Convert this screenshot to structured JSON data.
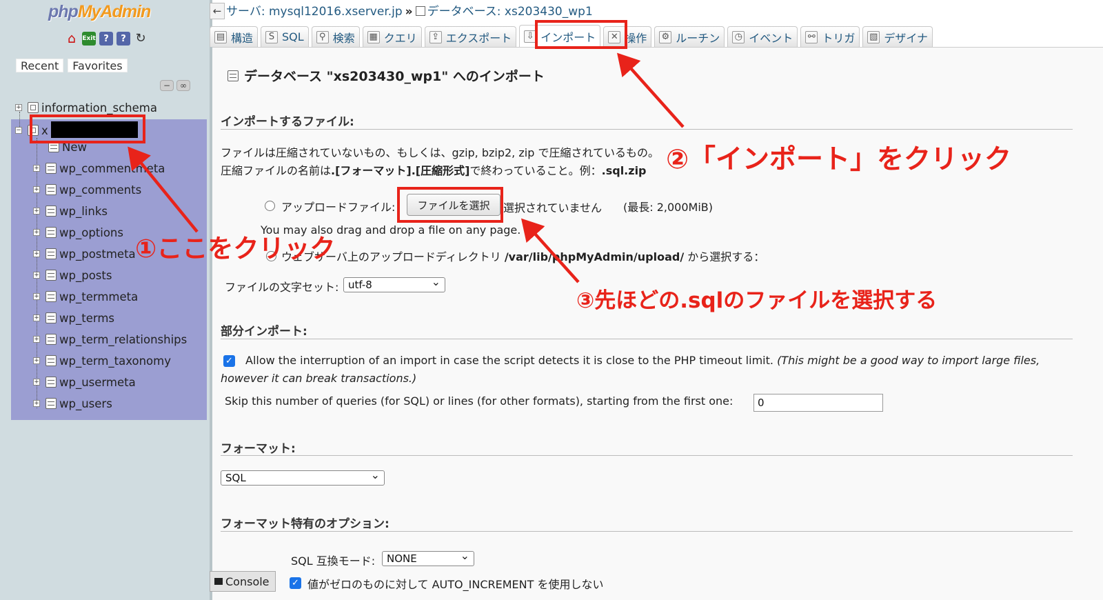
{
  "sidebar": {
    "logo_php": "php",
    "logo_myadmin": "MyAdmin",
    "nav_icons": [
      "home-icon",
      "exit-icon",
      "help-icon",
      "docs-icon",
      "reload-icon"
    ],
    "recent_label": "Recent",
    "favorites_label": "Favorites",
    "databases": [
      {
        "name": "information_schema"
      },
      {
        "name": "x",
        "new_label": "New",
        "tables": [
          "wp_commentmeta",
          "wp_comments",
          "wp_links",
          "wp_options",
          "wp_postmeta",
          "wp_posts",
          "wp_termmeta",
          "wp_terms",
          "wp_term_relationships",
          "wp_term_taxonomy",
          "wp_usermeta",
          "wp_users"
        ]
      }
    ]
  },
  "breadcrumb": {
    "server": "サーバ: mysql12016.xserver.jp",
    "separator": "»",
    "database": "データベース: xs203430_wp1"
  },
  "tabs": [
    {
      "label": "構造",
      "icon": "structure-icon"
    },
    {
      "label": "SQL",
      "icon": "sql-icon"
    },
    {
      "label": "検索",
      "icon": "search-icon"
    },
    {
      "label": "クエリ",
      "icon": "query-icon"
    },
    {
      "label": "エクスポート",
      "icon": "export-icon"
    },
    {
      "label": "インポート",
      "icon": "import-icon",
      "active": true
    },
    {
      "label": "操作",
      "icon": "operations-icon"
    },
    {
      "label": "ルーチン",
      "icon": "routines-icon"
    },
    {
      "label": "イベント",
      "icon": "events-icon"
    },
    {
      "label": "トリガ",
      "icon": "triggers-icon"
    },
    {
      "label": "デザイナ",
      "icon": "designer-icon"
    }
  ],
  "page": {
    "heading": "データベース \"xs203430_wp1\" へのインポート",
    "file_section": "インポートするファイル:",
    "file_desc_1": "ファイルは圧縮されていないもの、もしくは、gzip, bzip2, zip で圧縮されているもの。",
    "file_desc_2_prefix": "圧縮ファイルの名前は",
    "file_desc_2_format": ".[フォーマット].[圧縮形式]",
    "file_desc_2_mid": "で終わっていること。例：",
    "file_desc_2_example": ".sql.zip",
    "upload_label": "アップロードファイル:",
    "choose_file_button": "ファイルを選択",
    "no_file_selected": "選択されていません",
    "max_size": "(最長: 2,000MiB)",
    "drag_drop_note": "You may also drag and drop a file on any page.",
    "webserver_dir_prefix": "ウェブサーバ上のアップロードディレクトリ",
    "webserver_dir_path": "/var/lib/phpMyAdmin/upload/",
    "webserver_dir_suffix": "から選択する：",
    "charset_label": "ファイルの文字セット:",
    "charset_value": "utf-8",
    "partial_section": "部分インポート:",
    "allow_interrupt_text": "Allow the interruption of an import in case the script detects it is close to the PHP timeout limit.",
    "allow_interrupt_note_1": "(This might be a good way to import large files,",
    "allow_interrupt_note_2": "however it can break transactions.)",
    "skip_label": "Skip this number of queries (for SQL) or lines (for other formats), starting from the first one:",
    "skip_value": "0",
    "format_section": "フォーマット:",
    "format_value": "SQL",
    "format_options_section": "フォーマット特有のオプション:",
    "sql_compat_label": "SQL 互換モード:",
    "sql_compat_value": "NONE",
    "auto_increment_text": "値がゼロのものに対して AUTO_INCREMENT を使用しない",
    "console_label": "Console"
  },
  "annotations": {
    "step1": "①ここをクリック",
    "step2": "②「インポート」をクリック",
    "step3": "③先ほどの.sqlのファイルを選択する",
    "color": "#e8231a"
  },
  "colors": {
    "sidebar_bg": "#d0dce0",
    "selected_db_bg": "#9b9ed2",
    "link": "#235a81",
    "logo_php": "#6c78af",
    "logo_myadmin": "#f29a1e"
  }
}
